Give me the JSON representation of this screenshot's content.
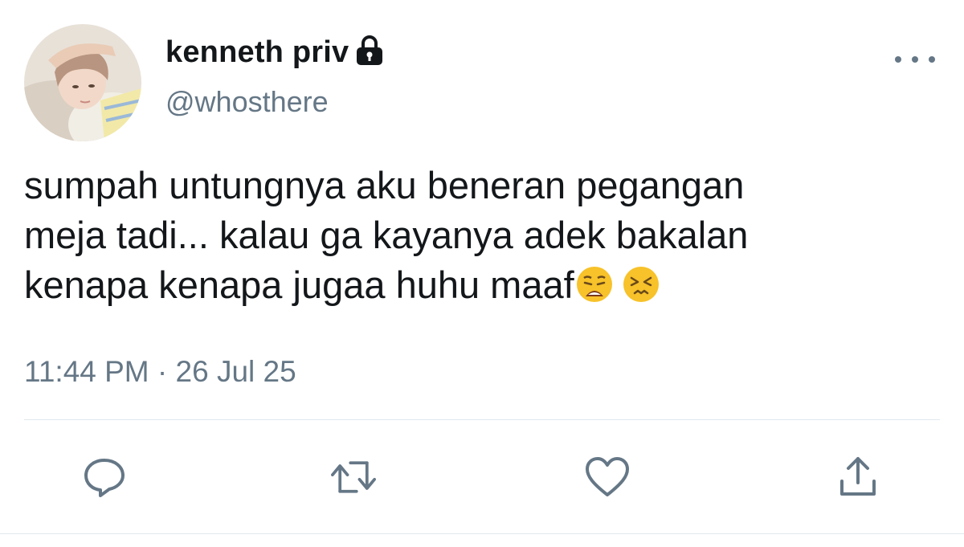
{
  "user": {
    "display_name": "kenneth priv",
    "handle": "@whosthere",
    "protected_icon": "lock-icon",
    "avatar": "profile-photo"
  },
  "tweet": {
    "text_lines": [
      "sumpah untungnya aku beneran pegangan",
      "meja tadi... kalau ga kayanya adek bakalan",
      "kenapa kenapa jugaa huhu maaf"
    ],
    "emojis": [
      "weary-face-emoji",
      "persevering-face-emoji"
    ],
    "timestamp": "11:44 PM · 26 Jul 25"
  },
  "actions": [
    {
      "name": "reply",
      "icon": "reply-icon"
    },
    {
      "name": "retweet",
      "icon": "retweet-icon"
    },
    {
      "name": "like",
      "icon": "heart-icon"
    },
    {
      "name": "share",
      "icon": "share-icon"
    }
  ],
  "colors": {
    "text": "#14171a",
    "secondary": "#657786",
    "divider": "#e1e8ed",
    "emoji": "#f7c22a"
  }
}
